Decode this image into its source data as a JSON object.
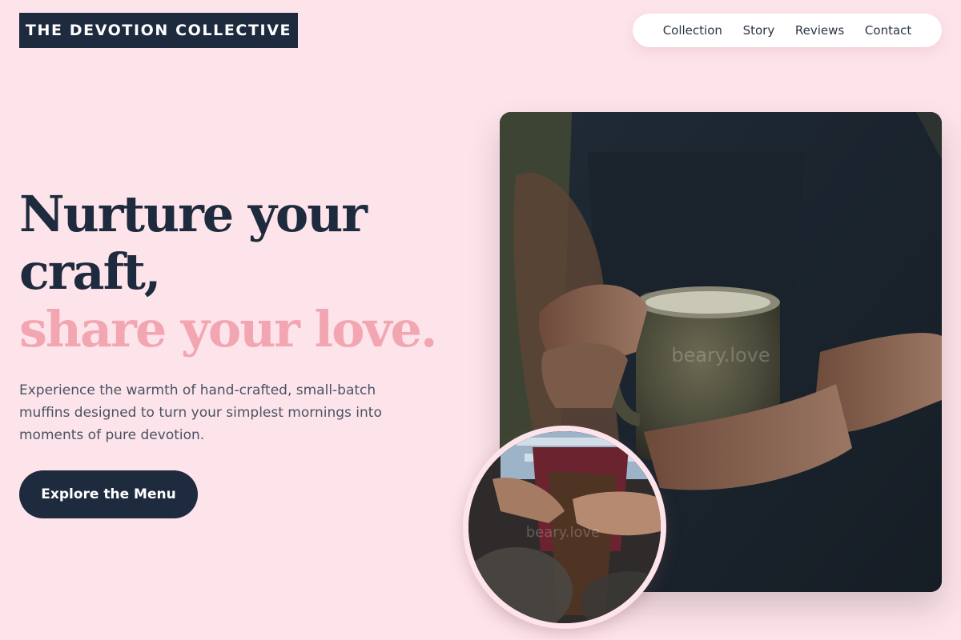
{
  "brand": {
    "logo_text": "THE DEVOTION COLLECTIVE"
  },
  "nav": {
    "items": [
      {
        "label": "Collection"
      },
      {
        "label": "Story"
      },
      {
        "label": "Reviews"
      },
      {
        "label": "Contact"
      }
    ]
  },
  "hero": {
    "headline_line1": "Nurture your",
    "headline_line2": "craft,",
    "headline_accent": "share your love.",
    "description": "Experience the warmth of hand-crafted, small-batch muffins designed to turn your simplest mornings into moments of pure devotion.",
    "cta_label": "Explore the Menu"
  },
  "images": {
    "main_watermark": "beary.love",
    "round_watermark": "beary.love"
  },
  "colors": {
    "background": "#fde4ea",
    "primary_dark": "#1e2a3d",
    "accent_pink": "#f2a6b2",
    "nav_background": "#ffffff"
  }
}
